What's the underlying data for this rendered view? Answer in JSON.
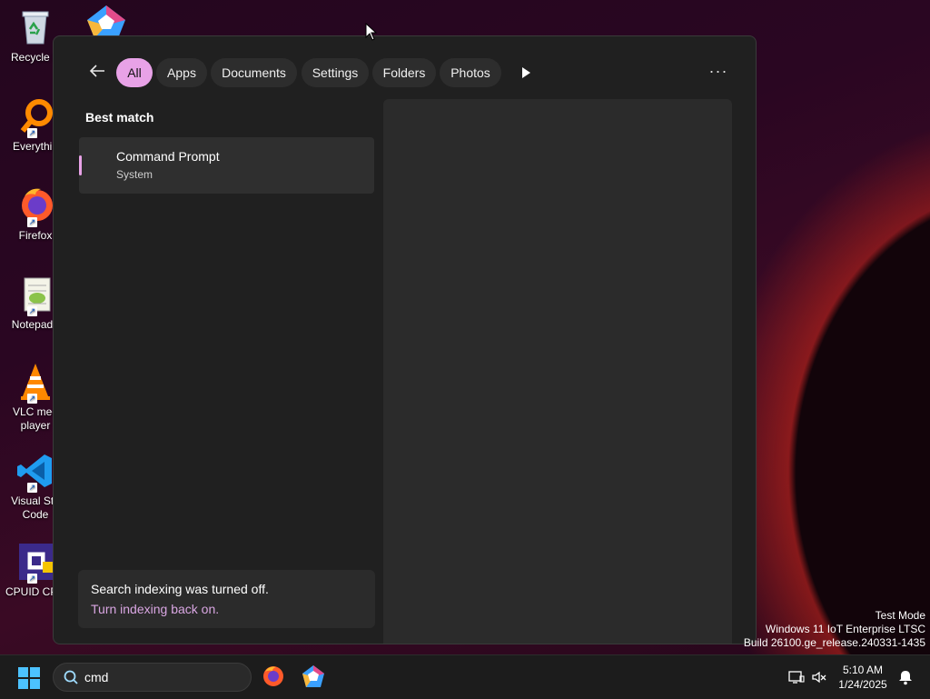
{
  "desktop": {
    "icons": [
      {
        "label": "Recycle B",
        "icon": "recycle-bin-icon"
      },
      {
        "label": "Everythin",
        "icon": "everything-search-icon"
      },
      {
        "label": "Firefox",
        "icon": "firefox-icon"
      },
      {
        "label": "Notepad+",
        "icon": "notepad-plus-plus-icon"
      },
      {
        "label": "VLC med\nplayer",
        "icon": "vlc-icon"
      },
      {
        "label": "Visual Stu\nCode",
        "icon": "vscode-icon"
      },
      {
        "label": "CPUID CPU",
        "icon": "cpuid-icon"
      }
    ]
  },
  "search_panel": {
    "filters": [
      "All",
      "Apps",
      "Documents",
      "Settings",
      "Folders",
      "Photos"
    ],
    "active_filter": "All",
    "best_match_label": "Best match",
    "result": {
      "title": "Command Prompt",
      "subtitle": "System"
    },
    "notice": {
      "message": "Search indexing was turned off.",
      "link": "Turn indexing back on."
    }
  },
  "watermark": {
    "line1": "Test Mode",
    "line2": "Windows 11 IoT Enterprise LTSC",
    "line3": "Build 26100.ge_release.240331-1435"
  },
  "taskbar": {
    "search_value": "cmd",
    "apps": [
      "firefox-icon",
      "copilot-icon"
    ],
    "tray": [
      "network-icon",
      "volume-muted-icon",
      "notification-bell-icon"
    ],
    "time": "5:10 AM",
    "date": "1/24/2025"
  },
  "colors": {
    "accent": "#e8a2e7",
    "link": "#d9a6e2",
    "start": "#4cc2ff"
  }
}
